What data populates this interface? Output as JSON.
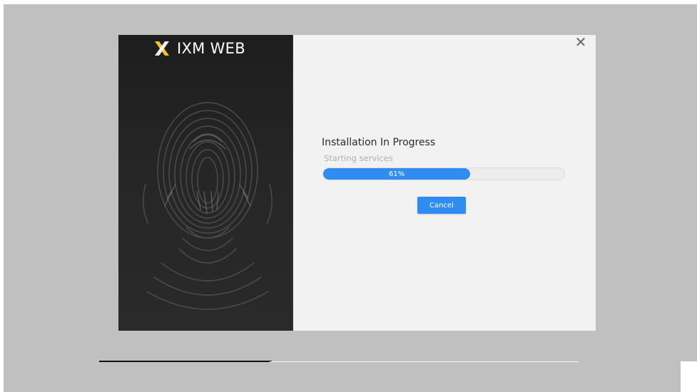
{
  "brand": {
    "name": "IXM WEB",
    "accent": "#f2c230"
  },
  "dialog": {
    "close_glyph": "✕",
    "title": "Installation In Progress",
    "status": "Starting services",
    "progress": {
      "percent": 61,
      "label": "61%",
      "color": "#2f8cf0"
    },
    "cancel_label": "Cancel"
  },
  "wizard": {
    "step_progress_fraction": 0.36
  }
}
